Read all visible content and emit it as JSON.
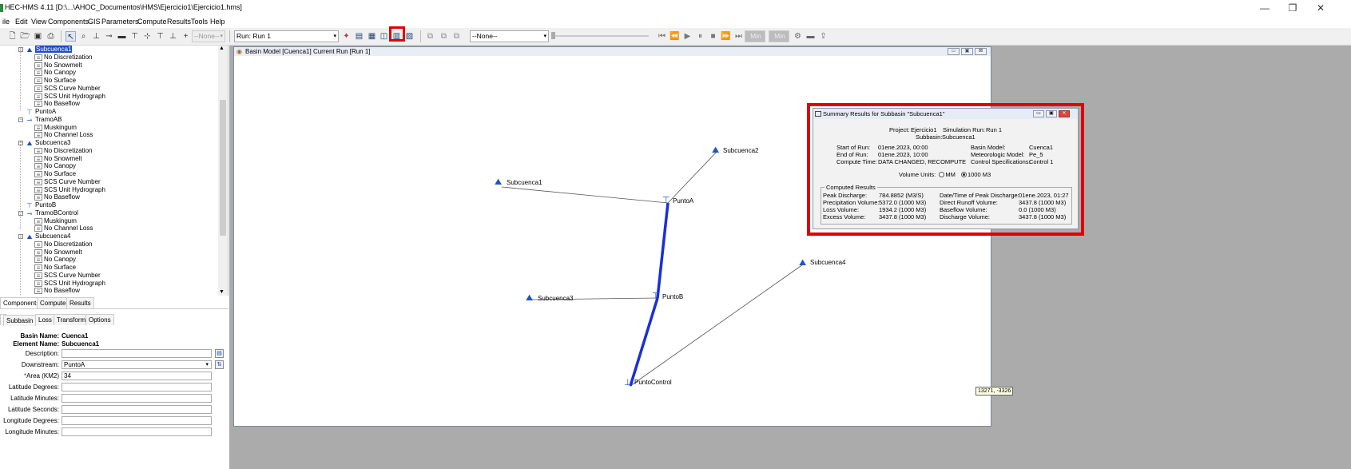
{
  "window": {
    "title": "HEC-HMS 4.11 [D:\\...\\AHOC_Documentos\\HMS\\Ejercicio1\\Ejercicio1.hms]",
    "controls": [
      "—",
      "❐",
      "✕"
    ]
  },
  "menu": [
    "ile",
    "Edit",
    "View",
    "Components",
    "GIS",
    "Parameters",
    "Compute",
    "Results",
    "Tools",
    "Help"
  ],
  "toolbar": {
    "none_select_1": "--None--",
    "run_select": "Run: Run 1",
    "none_select_2": "--None--",
    "min_label_1": "Min",
    "min_label_2": "Min"
  },
  "tree": {
    "nodes": [
      {
        "label": "Subcuenca1",
        "type": "subbasin",
        "level": 1,
        "selected": true
      },
      {
        "label": "No Discretization",
        "type": "method",
        "level": 2
      },
      {
        "label": "No Snowmelt",
        "type": "method",
        "level": 2
      },
      {
        "label": "No Canopy",
        "type": "method",
        "level": 2
      },
      {
        "label": "No Surface",
        "type": "method",
        "level": 2
      },
      {
        "label": "SCS Curve Number",
        "type": "method",
        "level": 2
      },
      {
        "label": "SCS Unit Hydrograph",
        "type": "method",
        "level": 2
      },
      {
        "label": "No Baseflow",
        "type": "method",
        "level": 2
      },
      {
        "label": "PuntoA",
        "type": "junction",
        "level": 1
      },
      {
        "label": "TramoAB",
        "type": "reach",
        "level": 1
      },
      {
        "label": "Muskingum",
        "type": "method",
        "level": 2
      },
      {
        "label": "No Channel Loss",
        "type": "method",
        "level": 2
      },
      {
        "label": "Subcuenca3",
        "type": "subbasin",
        "level": 1
      },
      {
        "label": "No Discretization",
        "type": "method",
        "level": 2
      },
      {
        "label": "No Snowmelt",
        "type": "method",
        "level": 2
      },
      {
        "label": "No Canopy",
        "type": "method",
        "level": 2
      },
      {
        "label": "No Surface",
        "type": "method",
        "level": 2
      },
      {
        "label": "SCS Curve Number",
        "type": "method",
        "level": 2
      },
      {
        "label": "SCS Unit Hydrograph",
        "type": "method",
        "level": 2
      },
      {
        "label": "No Baseflow",
        "type": "method",
        "level": 2
      },
      {
        "label": "PuntoB",
        "type": "junction",
        "level": 1
      },
      {
        "label": "TramoBControl",
        "type": "reach",
        "level": 1
      },
      {
        "label": "Muskingum",
        "type": "method",
        "level": 2
      },
      {
        "label": "No Channel Loss",
        "type": "method",
        "level": 2
      },
      {
        "label": "Subcuenca4",
        "type": "subbasin",
        "level": 1
      },
      {
        "label": "No Discretization",
        "type": "method",
        "level": 2
      },
      {
        "label": "No Snowmelt",
        "type": "method",
        "level": 2
      },
      {
        "label": "No Canopy",
        "type": "method",
        "level": 2
      },
      {
        "label": "No Surface",
        "type": "method",
        "level": 2
      },
      {
        "label": "SCS Curve Number",
        "type": "method",
        "level": 2
      },
      {
        "label": "SCS Unit Hydrograph",
        "type": "method",
        "level": 2
      },
      {
        "label": "No Baseflow",
        "type": "method",
        "level": 2
      }
    ]
  },
  "nav_tabs": [
    "Components",
    "Compute",
    "Results"
  ],
  "prop_tabs": [
    "Subbasin",
    "Loss",
    "Transform",
    "Options"
  ],
  "properties": {
    "basin_name_label": "Basin Name:",
    "basin_name": "Cuenca1",
    "element_name_label": "Element Name:",
    "element_name": "Subcuenca1",
    "fields": [
      {
        "label": "Description:",
        "value": ""
      },
      {
        "label": "Downstream:",
        "value": "PuntoA"
      },
      {
        "label": "Area (KM2)",
        "value": "34",
        "required": true
      },
      {
        "label": "Latitude Degrees:",
        "value": ""
      },
      {
        "label": "Latitude Minutes:",
        "value": ""
      },
      {
        "label": "Latitude Seconds:",
        "value": ""
      },
      {
        "label": "Longitude Degrees:",
        "value": ""
      },
      {
        "label": "Longitude Minutes:",
        "value": ""
      }
    ]
  },
  "basin_window": {
    "title": "Basin Model [Cuenca1] Current Run [Run 1]",
    "elements": {
      "subcuenca1": "Subcuenca1",
      "subcuenca2": "Subcuenca2",
      "subcuenca3": "Subcuenca3",
      "subcuenca4": "Subcuenca4",
      "puntoA": "PuntoA",
      "puntoB": "PuntoB",
      "puntoControl": "PuntoControl"
    },
    "coord_readout": "13271, -3326"
  },
  "summary": {
    "title": "Summary Results for Subbasin \"Subcuenca1\"",
    "project_label": "Project:",
    "project": "Ejercicio1",
    "sim_run_label": "Simulation Run:",
    "sim_run": "Run 1",
    "subbasin_label": "Subbasin:",
    "subbasin": "Subcuenca1",
    "start_label": "Start of Run:",
    "start": "01ene.2023, 00:00",
    "end_label": "End of Run:",
    "end": "01ene.2023, 10:00",
    "compute_label": "Compute Time:",
    "compute": "DATA CHANGED, RECOMPUTE",
    "basin_model_label": "Basin Model:",
    "basin_model": "Cuenca1",
    "met_model_label": "Meteorologic Model:",
    "met_model": "Pe_5",
    "control_label": "Control Specifications:",
    "control": "Control 1",
    "volume_units_label": "Volume Units:",
    "unit_mm": "MM",
    "unit_1000m3": "1000 M3",
    "computed_results_label": "Computed Results",
    "results_left": [
      {
        "label": "Peak Discharge:",
        "value": "784.8852 (M3/S)"
      },
      {
        "label": "Precipitation Volume:",
        "value": "5372.0 (1000 M3)"
      },
      {
        "label": "Loss Volume:",
        "value": "1934.2 (1000 M3)"
      },
      {
        "label": "Excess Volume:",
        "value": "3437.8 (1000 M3)"
      }
    ],
    "results_right": [
      {
        "label": "Date/Time of Peak Discharge:",
        "value": "01ene.2023, 01:27"
      },
      {
        "label": "Direct Runoff Volume:",
        "value": "3437.8 (1000 M3)"
      },
      {
        "label": "Baseflow Volume:",
        "value": "0.0 (1000 M3)"
      },
      {
        "label": "Discharge Volume:",
        "value": "3437.8 (1000 M3)"
      }
    ]
  },
  "colors": {
    "highlight_red": "#e00000",
    "reach_blue": "#1a2fd8",
    "selection_blue": "#1c4ccd",
    "workspace_gray": "#ababab"
  }
}
